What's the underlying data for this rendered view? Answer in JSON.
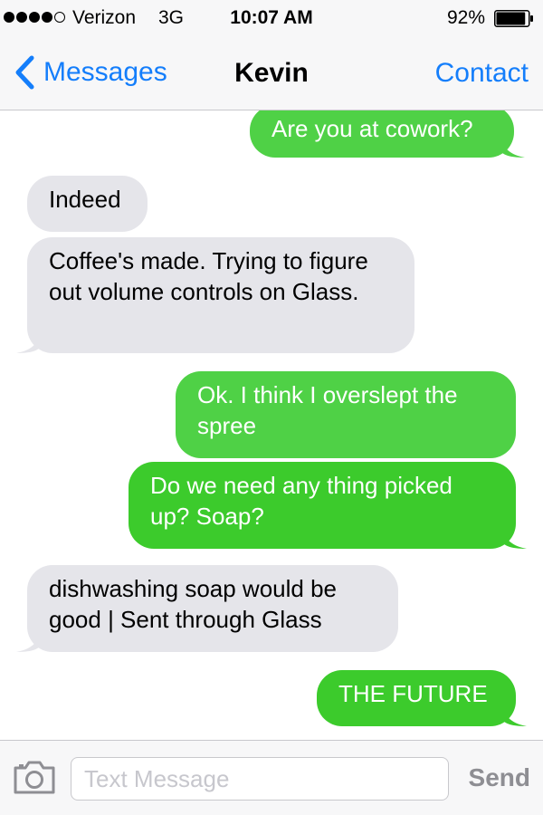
{
  "status_bar": {
    "signal_bars_filled": 4,
    "signal_bars_total": 5,
    "carrier": "Verizon",
    "network": "3G",
    "time": "10:07 AM",
    "battery_percent": "92%",
    "battery_level": 0.92
  },
  "nav": {
    "back_label": "Messages",
    "title": "Kevin",
    "contact_label": "Contact",
    "accent_color": "#147efb"
  },
  "messages": [
    {
      "direction": "outgoing",
      "text": "Are you at cowork?"
    },
    {
      "direction": "incoming",
      "text": "Indeed"
    },
    {
      "direction": "incoming",
      "text": "Coffee's made. Trying to figure out volume controls on Glass."
    },
    {
      "direction": "outgoing",
      "text": "Ok. I think I overslept the spree"
    },
    {
      "direction": "outgoing",
      "text": "Do we need any thing picked up? Soap?"
    },
    {
      "direction": "incoming",
      "text": "dishwashing soap would be good | Sent through Glass"
    },
    {
      "direction": "outgoing",
      "text": "THE FUTURE"
    }
  ],
  "colors": {
    "outgoing_bubble": "#4fd146",
    "incoming_bubble": "#e5e5ea"
  },
  "input": {
    "placeholder": "Text Message",
    "value": "",
    "send_label": "Send"
  },
  "icons": {
    "back": "chevron-left-icon",
    "camera": "camera-icon",
    "battery": "battery-icon",
    "signal": "signal-dots-icon"
  }
}
